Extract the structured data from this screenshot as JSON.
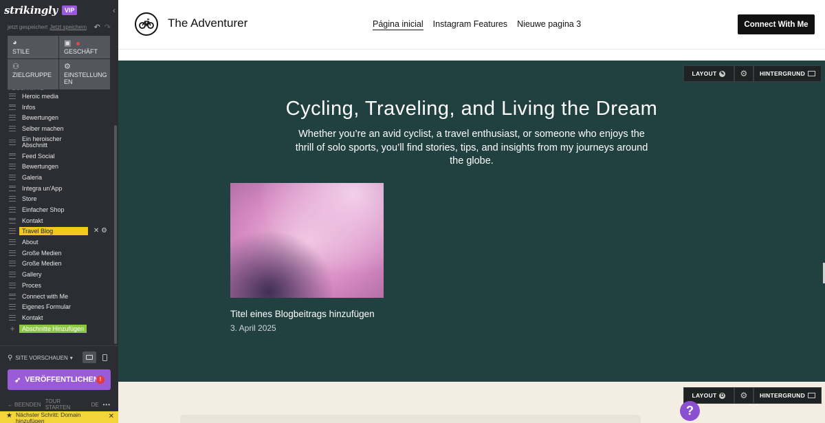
{
  "sidebar": {
    "logo": "strikingly",
    "vip": "VIP",
    "save_status": "jetzt gespeichert",
    "save_link": "Jetzt speichern",
    "tiles": [
      {
        "label": "STILE",
        "icon": "palette-icon"
      },
      {
        "label": "GESCHÄFT",
        "icon": "bag-icon"
      },
      {
        "label": "ZIELGRUPPE",
        "icon": "people-icon"
      },
      {
        "label": "EINSTELLUNG EN",
        "icon": "gear-icon"
      }
    ],
    "partial_label": "ABSCHNITTE",
    "sections": [
      "Heroic media",
      "Infos",
      "Bewertungen",
      "Selber machen",
      "Ein heroischer Abschnitt",
      "Feed Social",
      "Bewertungen",
      "Galeria",
      "Integra un'App",
      "Store",
      "Einfacher Shop",
      "Kontakt",
      "Travel Blog",
      "About",
      "Große Medien",
      "Große Medien",
      "Gallery",
      "Proces",
      "Connect with Me",
      "Eigenes Formular",
      "Kontakt"
    ],
    "active_section": "Travel Blog",
    "add_sections": "Abschnitte Hinzufügen",
    "preview": "SITE VORSCHAUEN",
    "publish": "VERÖFFENTLICHEN",
    "publish_warning": "!",
    "footer": {
      "end": "BEENDEN",
      "tour": "TOUR STARTEN",
      "lang": "DE"
    },
    "next_step": "Nächster Schritt: Domain hinzufügen",
    "colors": {
      "bg": "#2c2d33",
      "accent": "#9a5bd8",
      "active": "#f2c91a",
      "add": "#8dc63f"
    }
  },
  "header": {
    "site_name": "The Adventurer",
    "logo_icon": "bicycle-icon",
    "nav": [
      "Página inicial",
      "Instagram Features",
      "Nieuwe pagina 3"
    ],
    "cta": "Connect With Me"
  },
  "hero": {
    "controls": {
      "layout": "LAYOUT",
      "background": "HINTERGRUND"
    },
    "title": "Cycling, Traveling, and Living the Dream",
    "subtitle": "Whether you’re an avid cyclist, a travel enthusiast, or someone who enjoys the thrill of solo sports, you’ll find stories, tips, and insights from my journeys around the globe.",
    "post_title": "Titel eines Blogbeitrags hinzufügen",
    "post_date": "3. April 2025",
    "bg_color": "#214040"
  },
  "next_section": {
    "controls": {
      "layout": "LAYOUT",
      "layout_badge": "D",
      "background": "HINTERGRUND"
    }
  },
  "help": "?"
}
